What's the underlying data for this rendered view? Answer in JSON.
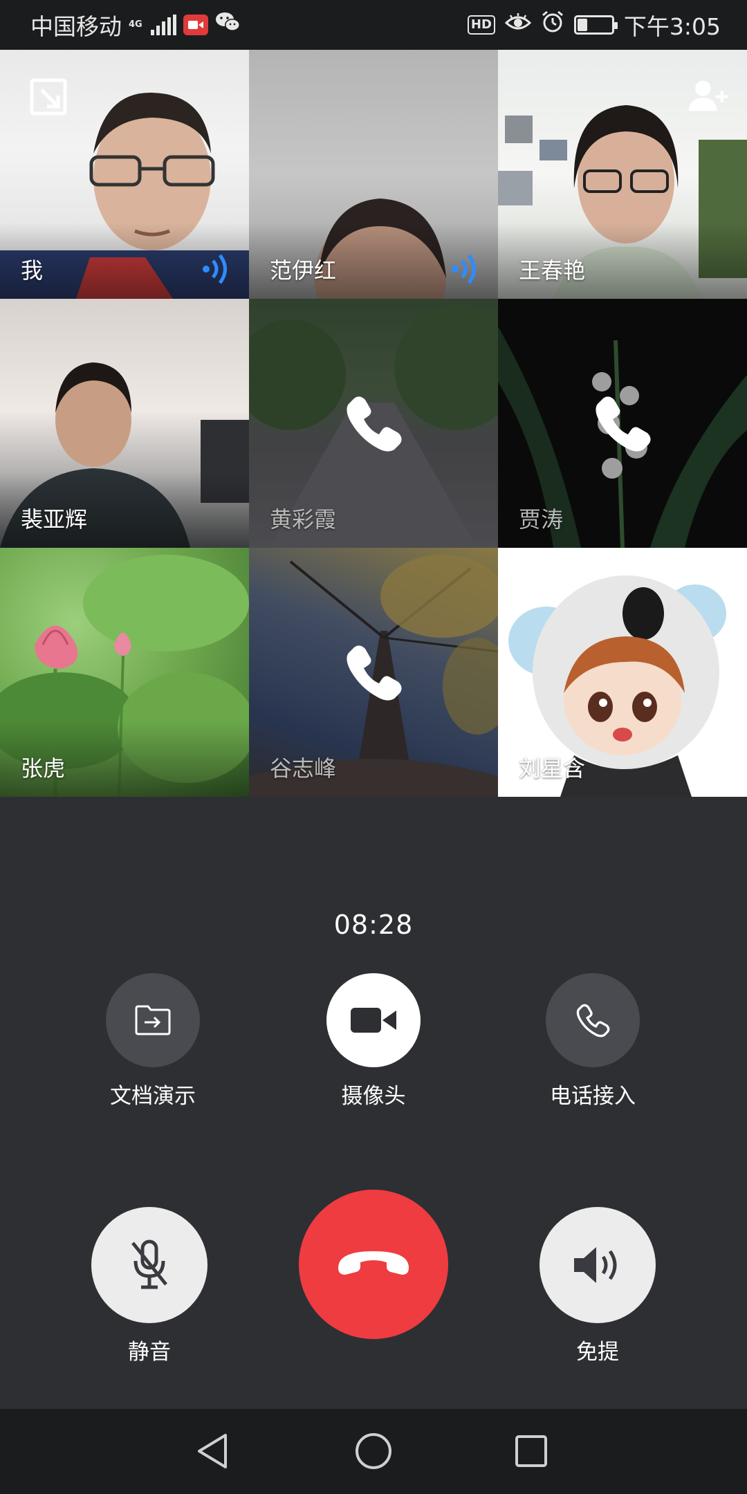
{
  "status_bar": {
    "carrier": "中国移动",
    "network_type": "4G",
    "time": "下午3:05",
    "hd_label": "HD",
    "battery_level": 0.3,
    "icons": [
      "signal-icon",
      "video-record-icon",
      "wechat-icon",
      "eye-icon",
      "alarm-icon",
      "battery-icon"
    ]
  },
  "participants": [
    {
      "name": "我",
      "status": "speaking"
    },
    {
      "name": "范伊红",
      "status": "speaking"
    },
    {
      "name": "王春艳",
      "status": "video"
    },
    {
      "name": "裴亚辉",
      "status": "video"
    },
    {
      "name": "黄彩霞",
      "status": "calling"
    },
    {
      "name": "贾涛",
      "status": "calling"
    },
    {
      "name": "张虎",
      "status": "video"
    },
    {
      "name": "谷志峰",
      "status": "calling"
    },
    {
      "name": "刘星含",
      "status": "video"
    }
  ],
  "call": {
    "duration": "08:28"
  },
  "controls": {
    "doc_share_label": "文档演示",
    "camera_label": "摄像头",
    "phone_join_label": "电话接入",
    "mute_label": "静音",
    "speaker_label": "免提"
  },
  "colors": {
    "hangup": "#ef3c40",
    "panel_bg": "#2e2f33",
    "speaking_indicator": "#2f8cff"
  }
}
